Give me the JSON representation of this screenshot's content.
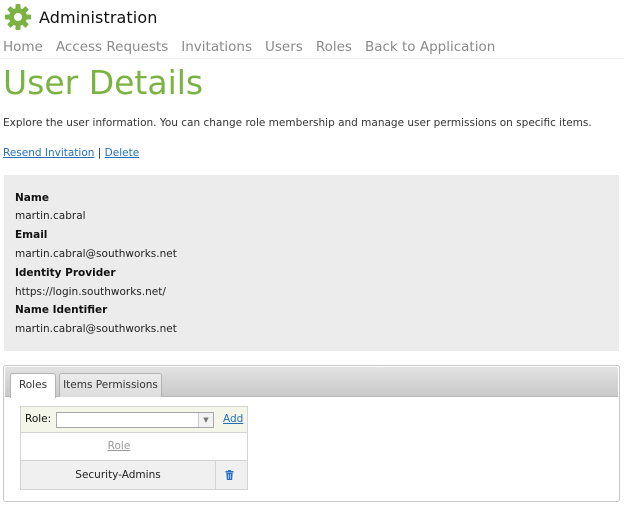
{
  "header": {
    "app_title": "Administration",
    "logo_icon": "gear-icon",
    "accent": "#7ab342"
  },
  "nav": {
    "items": [
      {
        "label": "Home"
      },
      {
        "label": "Access Requests"
      },
      {
        "label": "Invitations"
      },
      {
        "label": "Users"
      },
      {
        "label": "Roles"
      },
      {
        "label": "Back to Application"
      }
    ]
  },
  "page": {
    "title": "User Details",
    "intro": "Explore the user information. You can change role membership and manage user permissions on specific items.",
    "links": {
      "resend": "Resend Invitation",
      "separator": "|",
      "delete": "Delete"
    }
  },
  "details": {
    "name_label": "Name",
    "name_value": "martin.cabral",
    "email_label": "Email",
    "email_value": "martin.cabral@southworks.net",
    "idp_label": "Identity Provider",
    "idp_value": "https://login.southworks.net/",
    "nameid_label": "Name Identifier",
    "nameid_value": "martin.cabral@southworks.net"
  },
  "tabs": [
    {
      "label": "Roles",
      "active": true
    },
    {
      "label": "Items Permissions",
      "active": false
    }
  ],
  "roles": {
    "role_label": "Role:",
    "select_value": "",
    "add_label": "Add",
    "column_header": "Role",
    "rows": [
      {
        "role": "Security-Admins",
        "action_icon": "trash-icon"
      }
    ]
  }
}
